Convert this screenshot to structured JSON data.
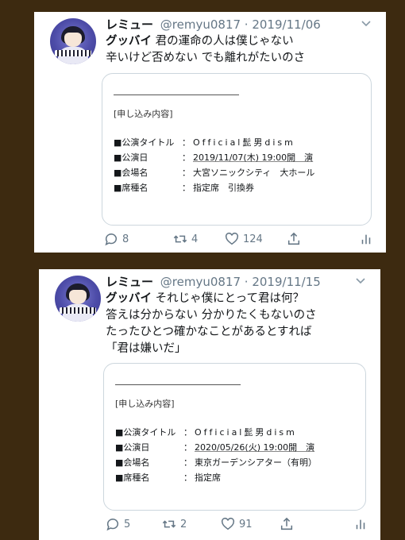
{
  "tweets": [
    {
      "author_name": "レミュー",
      "handle_date": "@remyu0817 · 2019/11/06",
      "text_lines": [
        {
          "strong": "グッバイ",
          "rest": " 君の運命の人は僕じゃない"
        },
        {
          "strong": "",
          "rest": "辛いけど否めない でも離れがたいのさ"
        }
      ],
      "embed": {
        "section": "[申し込み内容]",
        "rows": [
          {
            "label": "■公演タイトル",
            "colon": "：",
            "value": "Official髭男dism"
          },
          {
            "label": "■公演日",
            "colon": "：",
            "value": "2019/11/07(木) 19:00開　演"
          },
          {
            "label": "■会場名",
            "colon": "：",
            "value": "大宮ソニックシティ　大ホール"
          },
          {
            "label": "■席種名",
            "colon": "：",
            "value": "指定席　引換券"
          }
        ]
      },
      "actions": {
        "reply": "8",
        "retweet": "4",
        "like": "124"
      }
    },
    {
      "author_name": "レミュー",
      "handle_date": "@remyu0817 · 2019/11/15",
      "text_lines": [
        {
          "strong": "グッバイ",
          "rest": " それじゃ僕にとって君は何？"
        },
        {
          "strong": "",
          "rest": "答えは分からない 分かりたくもないのさ"
        },
        {
          "strong": "",
          "rest": "たったひとつ確かなことがあるとすれば"
        },
        {
          "strong": "",
          "rest": "「君は嫌いだ」"
        }
      ],
      "embed": {
        "section": "[申し込み内容]",
        "rows": [
          {
            "label": "■公演タイトル",
            "colon": "：",
            "value": "Official髭男dism"
          },
          {
            "label": "■公演日",
            "colon": "：",
            "value": "2020/05/26(火) 19:00開　演"
          },
          {
            "label": "■会場名",
            "colon": "：",
            "value": "東京ガーデンシアター（有明）"
          },
          {
            "label": "■席種名",
            "colon": "：",
            "value": "指定席"
          }
        ]
      },
      "actions": {
        "reply": "5",
        "retweet": "2",
        "like": "91"
      }
    }
  ]
}
